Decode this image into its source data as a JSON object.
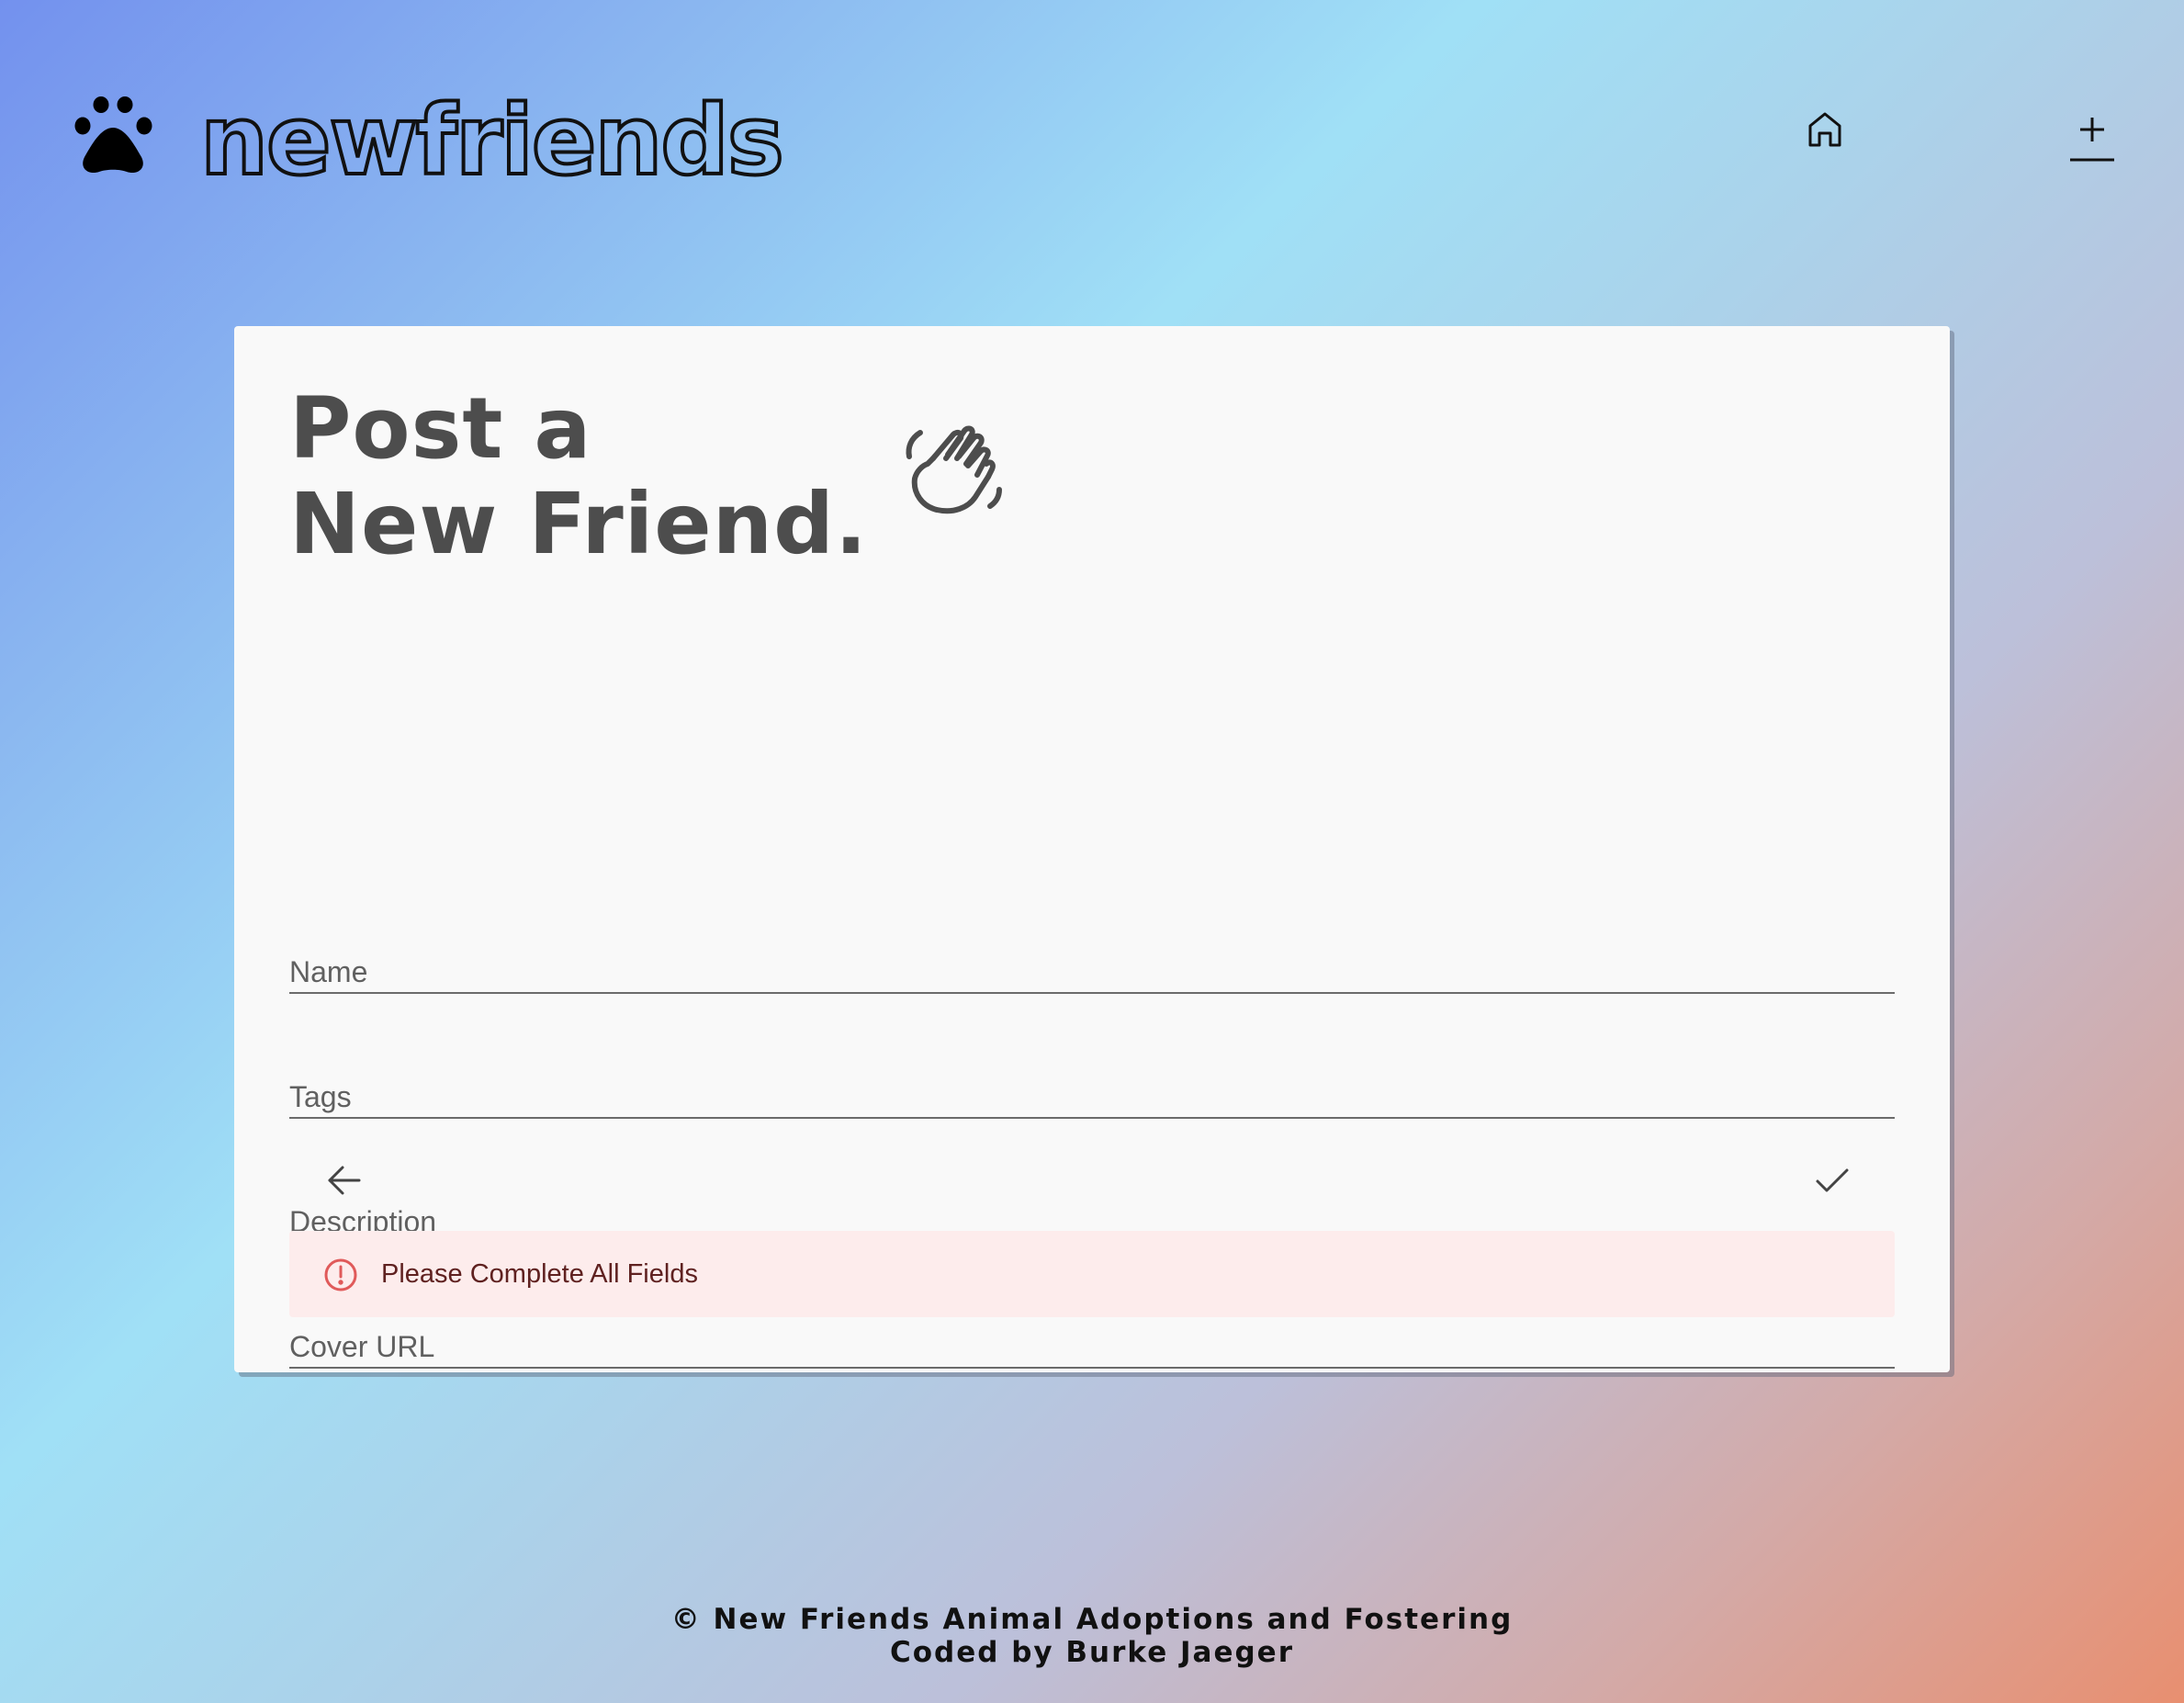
{
  "header": {
    "logo_text": "newfriends",
    "logo_icon": "paw-icon",
    "nav": [
      {
        "icon": "home-icon"
      },
      {
        "icon": "add-icon"
      }
    ]
  },
  "form": {
    "title_line1": "Post a",
    "title_line2": "New Friend.",
    "title_icon": "waving-hand-icon",
    "fields": {
      "name": {
        "placeholder": "Name",
        "value": ""
      },
      "tags": {
        "placeholder": "Tags",
        "value": ""
      },
      "description": {
        "placeholder": "Description",
        "value": ""
      },
      "cover_url": {
        "placeholder": "Cover URL",
        "value": ""
      }
    },
    "actions": {
      "back_icon": "arrow-left-icon",
      "submit_icon": "check-icon"
    },
    "alert": {
      "icon": "error-outline-icon",
      "message": "Please Complete All Fields",
      "color": "#5f2120",
      "background": "#fdecec",
      "icon_color": "#e05a5a"
    }
  },
  "footer": {
    "line1": "© New Friends Animal Adoptions and Fostering",
    "line2": "Coded by Burke Jaeger"
  }
}
